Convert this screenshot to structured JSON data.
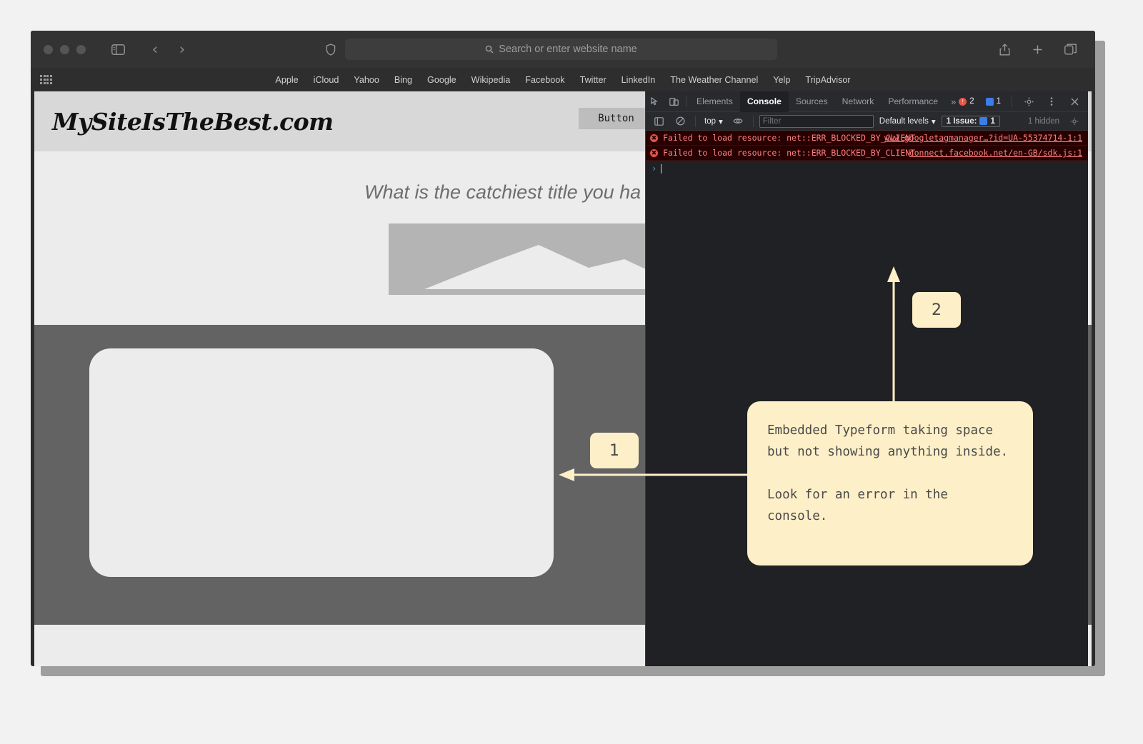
{
  "browser": {
    "name": "safari-browser-window",
    "traffic_lights": [
      "close",
      "minimize",
      "zoom"
    ],
    "sidebar_toggle": "sidebar-icon",
    "back": "chevron-left-icon",
    "forward": "chevron-right-icon",
    "shield": "shield-icon",
    "address": {
      "placeholder": "Search or enter website name",
      "value": "",
      "search_icon": "search-icon"
    },
    "right_icons": [
      "share-icon",
      "new-tab-icon",
      "tab-overview-icon"
    ],
    "bookmarks": [
      "Apple",
      "iCloud",
      "Yahoo",
      "Bing",
      "Google",
      "Wikipedia",
      "Facebook",
      "Twitter",
      "LinkedIn",
      "The Weather Channel",
      "Yelp",
      "TripAdvisor"
    ]
  },
  "page": {
    "logo": "MySiteIsTheBest.com",
    "header_button": "Button",
    "hero_title": "What is the catchiest title you ha",
    "hero_image_alt": "mountain-placeholder-image"
  },
  "devtools": {
    "tabs": [
      {
        "label": "Elements",
        "active": false
      },
      {
        "label": "Console",
        "active": true
      },
      {
        "label": "Sources",
        "active": false
      },
      {
        "label": "Network",
        "active": false
      },
      {
        "label": "Performance",
        "active": false
      }
    ],
    "more_tabs": "»",
    "error_badge": "2",
    "message_badge": "1",
    "inspect_icon": "inspect-element-icon",
    "device_icon": "device-toolbar-icon",
    "settings_icon": "gear-icon",
    "menu_icon": "kebab-menu-icon",
    "close_icon": "close-icon",
    "console_toolbar": {
      "sidebar_icon": "console-sidebar-icon",
      "clear_icon": "clear-console-icon",
      "context": "top",
      "eye_icon": "live-expression-icon",
      "filter_placeholder": "Filter",
      "levels": "Default levels",
      "issues_label": "1 Issue:",
      "issues_count": "1",
      "hidden_label": "1 hidden",
      "settings_icon": "console-settings-icon"
    },
    "console_messages": [
      {
        "text": "Failed to load resource: net::ERR_BLOCKED_BY_CLIENT",
        "source": "www.googletagmanager…?id=UA-55374714-1:1"
      },
      {
        "text": "Failed to load resource: net::ERR_BLOCKED_BY_CLIENT",
        "source": "connect.facebook.net/en-GB/sdk.js:1"
      }
    ],
    "prompt_symbol": "›"
  },
  "annotations": {
    "marker_1": "1",
    "marker_2": "2",
    "callout_line_1": "Embedded Typeform taking space but not showing anything inside.",
    "callout_line_2": "Look for an error in the console.",
    "accent_color": "#fdefc8"
  }
}
